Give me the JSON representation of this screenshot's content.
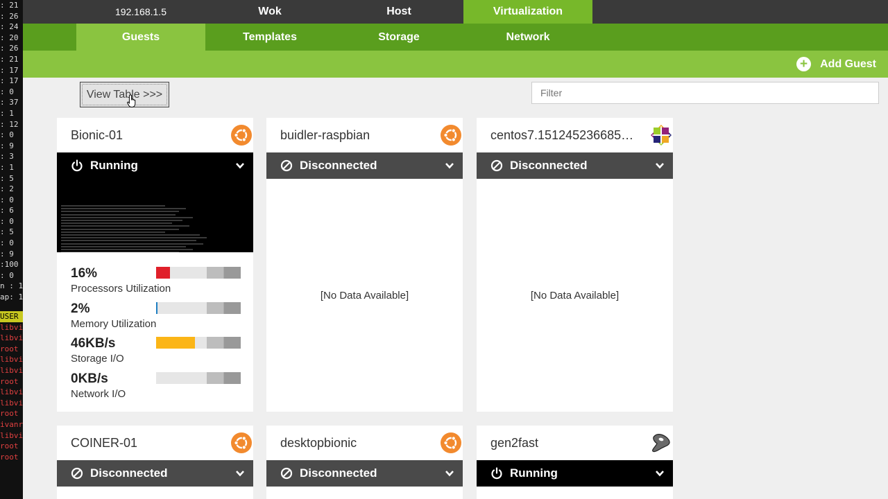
{
  "terminal_strip": {
    "lines": [
      ": 21",
      ": 26",
      ": 24",
      ": 20",
      ": 26",
      ": 21",
      ": 17",
      ": 17",
      ": 0",
      ": 37",
      ": 1",
      ": 12",
      ": 0",
      ": 9",
      ": 3",
      ": 1",
      ": 5",
      ": 2",
      ": 0",
      ": 6",
      ": 0",
      ": 5",
      ": 0",
      ": 9",
      ":100",
      ": 0",
      "n : 1",
      "ap: 1"
    ],
    "lower_lines": [
      "USER",
      "libvi",
      "libvi",
      "root",
      "libvi",
      "libvi",
      "root",
      "libvi",
      "libvi",
      "root",
      "ivanr",
      "libvi",
      "root",
      "root"
    ]
  },
  "topnav": {
    "items": [
      {
        "label": "192.168.1.5"
      },
      {
        "label": "Wok"
      },
      {
        "label": "Host"
      },
      {
        "label": "Virtualization"
      }
    ]
  },
  "subnav": {
    "items": [
      {
        "label": "Guests"
      },
      {
        "label": "Templates"
      },
      {
        "label": "Storage"
      },
      {
        "label": "Network"
      }
    ]
  },
  "actions": {
    "add_guest": "Add Guest"
  },
  "toolbar": {
    "view_table": "View Table >>>",
    "filter_placeholder": "Filter"
  },
  "guests": [
    {
      "name": "Bionic-01",
      "os_icon": "ubuntu-icon",
      "state": "Running",
      "metrics": [
        {
          "value": "16%",
          "label": "Processors Utilization",
          "fraction": 0.16,
          "color": "#e0202a"
        },
        {
          "value": "2%",
          "label": "Memory Utilization",
          "fraction": 0.02,
          "color": "#1e7fc2"
        },
        {
          "value": "46KB/s",
          "label": "Storage I/O",
          "fraction": 0.46,
          "color": "#fbb517"
        },
        {
          "value": "0KB/s",
          "label": "Network I/O",
          "fraction": 0,
          "color": "#999"
        }
      ]
    },
    {
      "name": "buidler-raspbian",
      "os_icon": "ubuntu-icon",
      "state": "Disconnected",
      "no_data": "[No Data Available]"
    },
    {
      "name": "centos7.151245236685…",
      "os_icon": "centos-icon",
      "state": "Disconnected",
      "no_data": "[No Data Available]"
    },
    {
      "name": "COINER-01",
      "os_icon": "ubuntu-icon",
      "state": "Disconnected"
    },
    {
      "name": "desktopbionic",
      "os_icon": "ubuntu-icon",
      "state": "Disconnected"
    },
    {
      "name": "gen2fast",
      "os_icon": "gentoo-icon",
      "state": "Running"
    }
  ],
  "colors": {
    "top_active": "#77b82a",
    "sub_bg": "#5a9e1e",
    "action_bg": "#8ac440",
    "state_bar": "#4a4a4a",
    "ubuntu": "#f28a2e"
  }
}
